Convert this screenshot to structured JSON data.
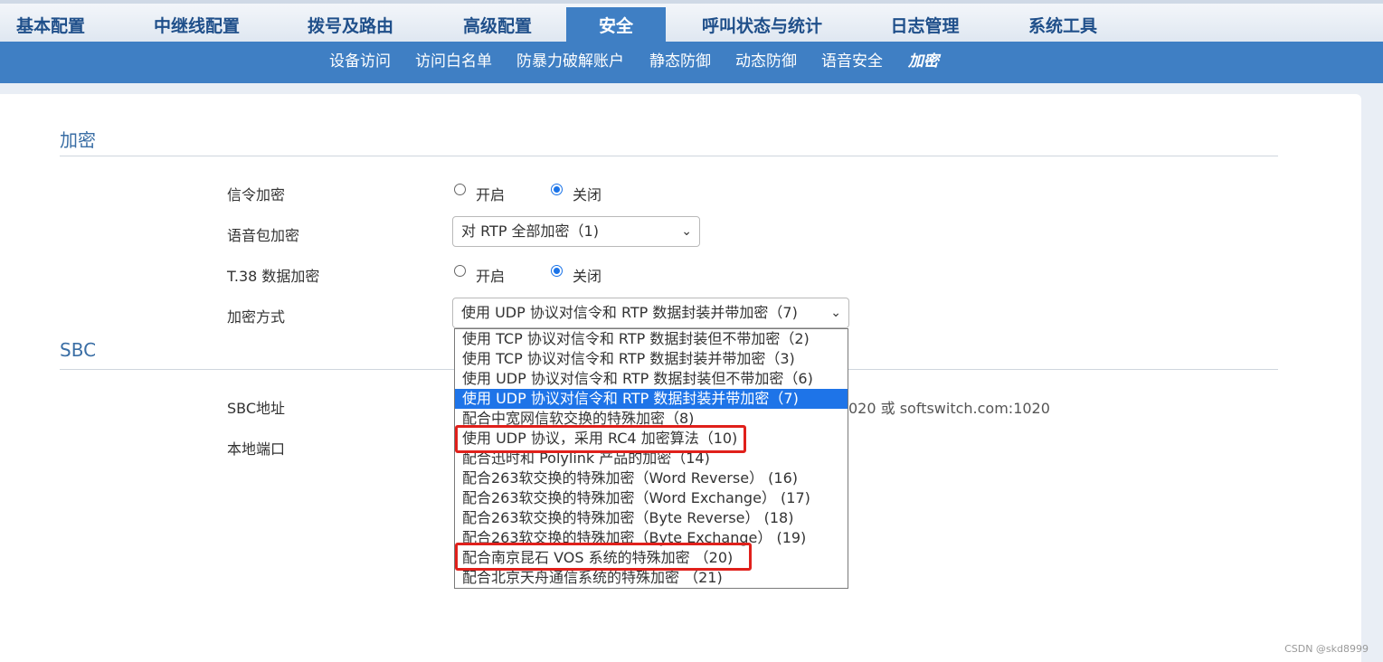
{
  "top_nav": {
    "items": [
      {
        "label": "基本配置"
      },
      {
        "label": "中继线配置"
      },
      {
        "label": "拨号及路由"
      },
      {
        "label": "高级配置"
      },
      {
        "label": "安全"
      },
      {
        "label": "呼叫状态与统计"
      },
      {
        "label": "日志管理"
      },
      {
        "label": "系统工具"
      }
    ],
    "active": "安全"
  },
  "sub_nav": {
    "items": [
      {
        "label": "设备访问"
      },
      {
        "label": "访问白名单"
      },
      {
        "label": "防暴力破解账户"
      },
      {
        "label": "静态防御"
      },
      {
        "label": "动态防御"
      },
      {
        "label": "语音安全"
      },
      {
        "label": "加密"
      }
    ],
    "active": "加密"
  },
  "encryption": {
    "section_title": "加密",
    "signaling": {
      "label": "信令加密",
      "on": "开启",
      "off": "关闭",
      "value": "关闭"
    },
    "voice": {
      "label": "语音包加密",
      "value": "对 RTP 全部加密（1)"
    },
    "t38": {
      "label": "T.38 数据加密",
      "on": "开启",
      "off": "关闭",
      "value": "关闭"
    },
    "method": {
      "label": "加密方式",
      "value": "使用 UDP 协议对信令和 RTP 数据封装并带加密（7)",
      "options": [
        "使用 TCP 协议对信令和 RTP 数据封装但不带加密（2)",
        "使用 TCP 协议对信令和 RTP 数据封装并带加密（3)",
        "使用 UDP 协议对信令和 RTP 数据封装但不带加密（6)",
        "使用 UDP 协议对信令和 RTP 数据封装并带加密（7)",
        "配合中宽网信软交换的特殊加密（8)",
        "使用 UDP 协议，采用 RC4 加密算法（10)",
        "配合迅时和 Polylink 产品的加密（14)",
        "配合263软交换的特殊加密（Word Reverse） (16)",
        "配合263软交换的特殊加密（Word Exchange） (17)",
        "配合263软交换的特殊加密（Byte Reverse） (18)",
        "配合263软交换的特殊加密（Byte Exchange） (19)",
        "配合南京昆石 VOS 系统的特殊加密 （20)",
        "配合北京天舟通信系统的特殊加密 （21)"
      ],
      "selected_option": "使用 UDP 协议对信令和 RTP 数据封装并带加密（7)"
    }
  },
  "sbc": {
    "section_title": "SBC",
    "address_label": "SBC地址",
    "address_hint": "020 或 softswitch.com:1020",
    "port_label": "本地端口"
  },
  "watermark": "CSDN @skd8999",
  "colors": {
    "primary": "#3f7fc4",
    "selected": "#1e74e8",
    "highlight": "#e0201b"
  }
}
